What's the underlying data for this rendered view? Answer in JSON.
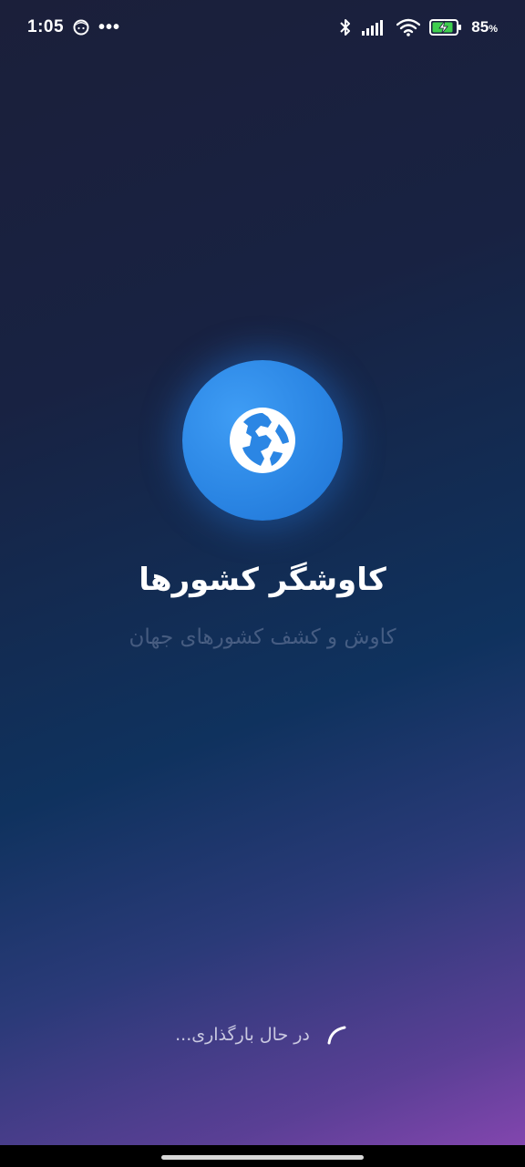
{
  "status_bar": {
    "time": "1:05",
    "more": "•••",
    "battery_percent": "85",
    "battery_unit": "%",
    "icons": [
      "face-icon",
      "bluetooth-icon",
      "signal-icon",
      "wifi-icon",
      "battery-charging-icon"
    ]
  },
  "splash": {
    "logo_icon": "globe-icon",
    "title": "کاوشگر کشورها",
    "subtitle": "کاوش و کشف کشورهای جهان",
    "loading_text": "در حال بارگذاری...",
    "accent_color": "#2b86e4"
  }
}
